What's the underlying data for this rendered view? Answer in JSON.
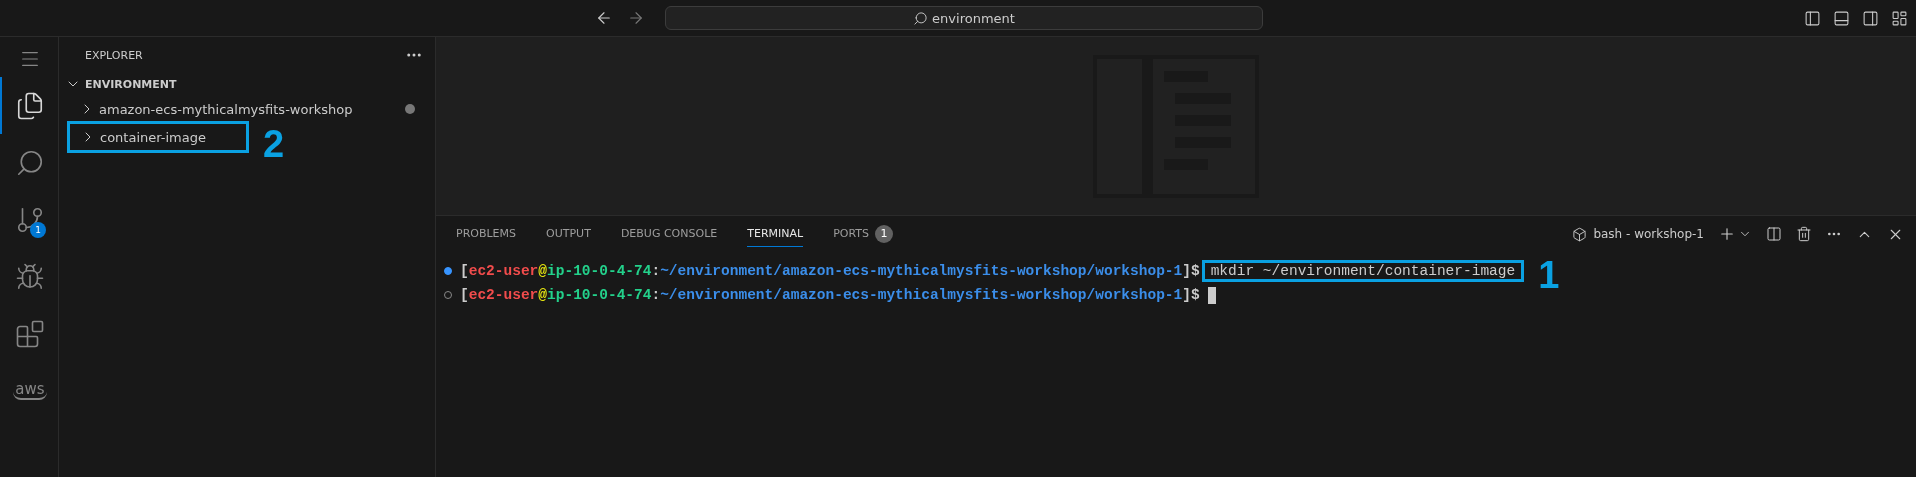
{
  "title_bar": {
    "search": "environment"
  },
  "activity_bar": [
    {
      "kind": "menu"
    },
    {
      "kind": "explorer",
      "selected": true
    },
    {
      "kind": "search",
      "selected": false
    },
    {
      "kind": "source_control",
      "selected": false,
      "badge": "1"
    },
    {
      "kind": "run_debug",
      "selected": false
    },
    {
      "kind": "extensions",
      "selected": false
    },
    {
      "kind": "aws",
      "selected": false,
      "label": "aws"
    }
  ],
  "sidebar": {
    "title": "EXPLORER",
    "section": {
      "title": "ENVIRONMENT",
      "expanded": true,
      "items": [
        {
          "name": "amazon-ecs-mythicalmysfits-workshop",
          "expanded": false,
          "modified": true
        },
        {
          "name": "container-image",
          "expanded": false,
          "modified": false,
          "annotation": "2"
        }
      ]
    }
  },
  "panel": {
    "tabs": [
      {
        "label": "PROBLEMS",
        "selected": false
      },
      {
        "label": "OUTPUT",
        "selected": false
      },
      {
        "label": "DEBUG CONSOLE",
        "selected": false
      },
      {
        "label": "TERMINAL",
        "selected": true
      },
      {
        "label": "PORTS",
        "selected": false,
        "badge": "1"
      }
    ],
    "terminal_name": "bash - workshop-1",
    "lines": [
      {
        "succeeded": true,
        "prompt": [
          {
            "text": "[",
            "color": "#cccccc"
          },
          {
            "text": "ec2-user",
            "color": "#f14c4c"
          },
          {
            "text": "@",
            "color": "#e5e510"
          },
          {
            "text": "ip-10-0-4-74",
            "color": "#23d18b"
          },
          {
            "text": ":",
            "color": "#cccccc"
          },
          {
            "text": "~/environment/amazon-ecs-mythicalmysfits-workshop/workshop-1",
            "color": "#3b8eea"
          },
          {
            "text": "]$",
            "color": "#cccccc"
          }
        ],
        "command": "mkdir ~/environment/container-image",
        "annotation": "1",
        "cursor": false
      },
      {
        "succeeded": false,
        "prompt": [
          {
            "text": "[",
            "color": "#cccccc"
          },
          {
            "text": "ec2-user",
            "color": "#f14c4c"
          },
          {
            "text": "@",
            "color": "#e5e510"
          },
          {
            "text": "ip-10-0-4-74",
            "color": "#23d18b"
          },
          {
            "text": ":",
            "color": "#cccccc"
          },
          {
            "text": "~/environment/amazon-ecs-mythicalmysfits-workshop/workshop-1",
            "color": "#3b8eea"
          },
          {
            "text": "]$",
            "color": "#cccccc"
          }
        ],
        "cursor": true
      }
    ]
  }
}
